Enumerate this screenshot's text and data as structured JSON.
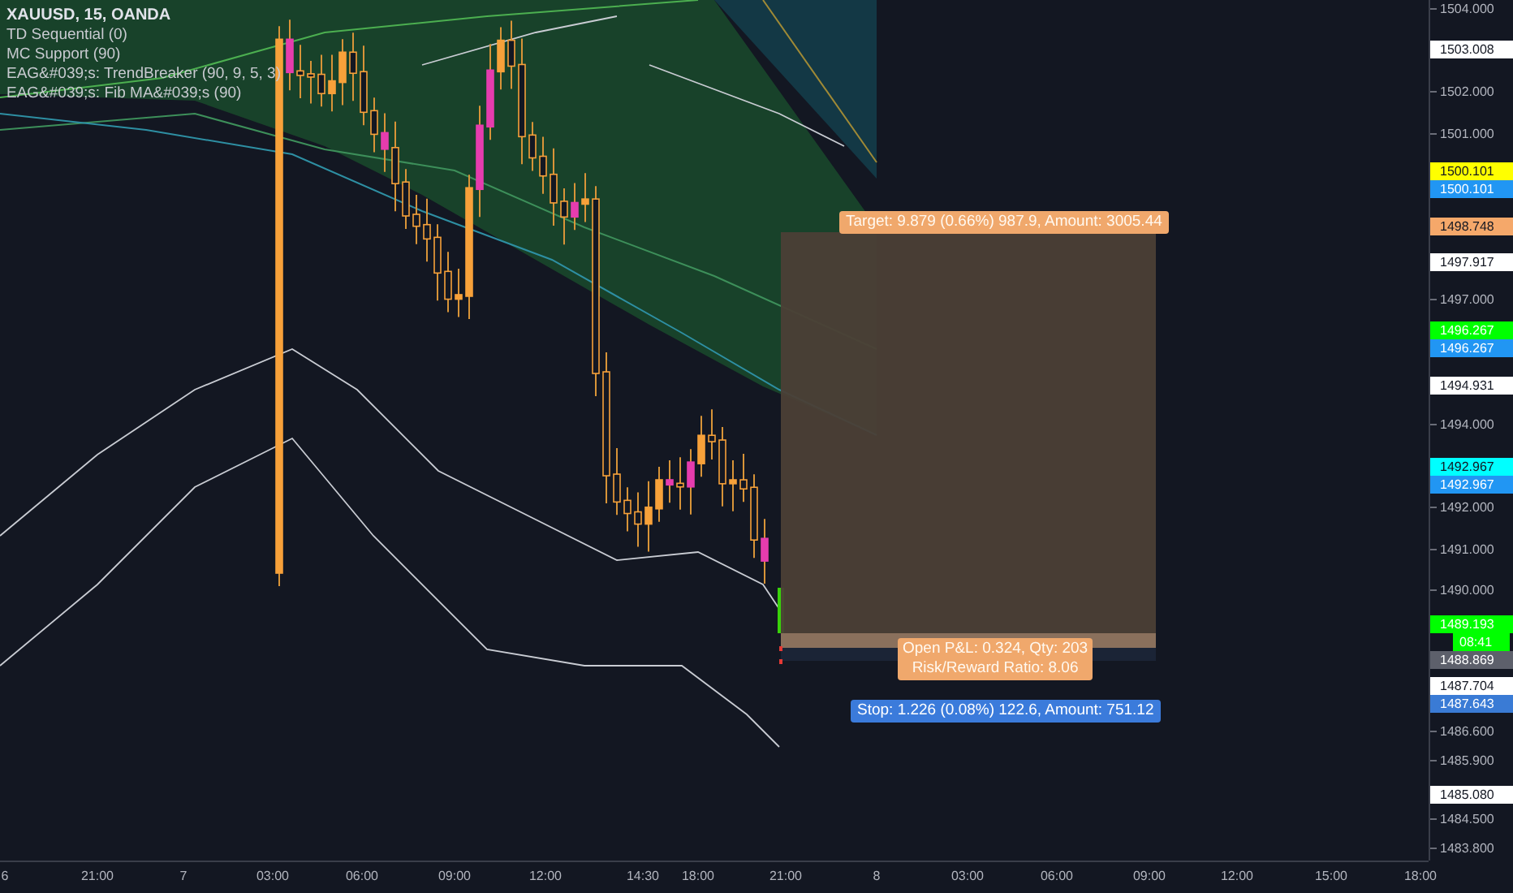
{
  "legend": {
    "symbol": "XAUUSD, 15, OANDA",
    "indicators": [
      "TD Sequential (0)",
      "MC Support (90)",
      "EAG&#039;s: TrendBreaker (90, 9, 5, 3)",
      "EAG&#039;s: Fib MA&#039;s (90)"
    ]
  },
  "position": {
    "target_label": "Target: 9.879 (0.66%) 987.9, Amount: 3005.44",
    "open_pnl_label": "Open P&L: 0.324, Qty: 203",
    "risk_reward_label": "Risk/Reward Ratio: 8.06",
    "stop_label": "Stop: 1.226 (0.08%) 122.6, Amount: 751.12"
  },
  "price_axis": [
    {
      "kind": "tick",
      "text": "1504.000"
    },
    {
      "kind": "tag",
      "text": "1503.008",
      "color": "#ffffff"
    },
    {
      "kind": "tick",
      "text": "1502.000"
    },
    {
      "kind": "tick",
      "text": "1501.000"
    },
    {
      "kind": "tag",
      "text": "1500.101",
      "color": "#ffff00"
    },
    {
      "kind": "tag",
      "text": "1500.101",
      "color": "#2196f3"
    },
    {
      "kind": "tag",
      "text": "1498.748",
      "color": "#f5a86a"
    },
    {
      "kind": "tag",
      "text": "1497.917",
      "color": "#ffffff"
    },
    {
      "kind": "tick",
      "text": "1497.000"
    },
    {
      "kind": "tag",
      "text": "1496.267",
      "color": "#00ff00"
    },
    {
      "kind": "tag",
      "text": "1496.267",
      "color": "#2196f3"
    },
    {
      "kind": "tag",
      "text": "1494.931",
      "color": "#ffffff"
    },
    {
      "kind": "tick",
      "text": "1494.000"
    },
    {
      "kind": "tag",
      "text": "1492.967",
      "color": "#00ffff"
    },
    {
      "kind": "tag",
      "text": "1492.967",
      "color": "#2196f3"
    },
    {
      "kind": "tick",
      "text": "1492.000"
    },
    {
      "kind": "tick",
      "text": "1491.000"
    },
    {
      "kind": "tick",
      "text": "1490.000"
    },
    {
      "kind": "tag",
      "text": "1489.193",
      "color": "#00ff00"
    },
    {
      "kind": "countdown",
      "text": "08:41",
      "color": "#00ff00"
    },
    {
      "kind": "tag",
      "text": "1488.869",
      "color": "#5d606b"
    },
    {
      "kind": "tag",
      "text": "1487.704",
      "color": "#ffffff"
    },
    {
      "kind": "tag",
      "text": "1487.643",
      "color": "#3a7bd5"
    },
    {
      "kind": "tick",
      "text": "1486.600"
    },
    {
      "kind": "tick",
      "text": "1485.900"
    },
    {
      "kind": "tag",
      "text": "1485.080",
      "color": "#ffffff"
    },
    {
      "kind": "tick",
      "text": "1484.500"
    },
    {
      "kind": "tick",
      "text": "1483.800"
    }
  ],
  "time_axis": [
    "6",
    "21:00",
    "7",
    "03:00",
    "06:00",
    "09:00",
    "12:00",
    "14:30",
    "18:00",
    "21:00",
    "8",
    "03:00",
    "06:00",
    "09:00",
    "12:00",
    "15:00",
    "18:00"
  ]
}
